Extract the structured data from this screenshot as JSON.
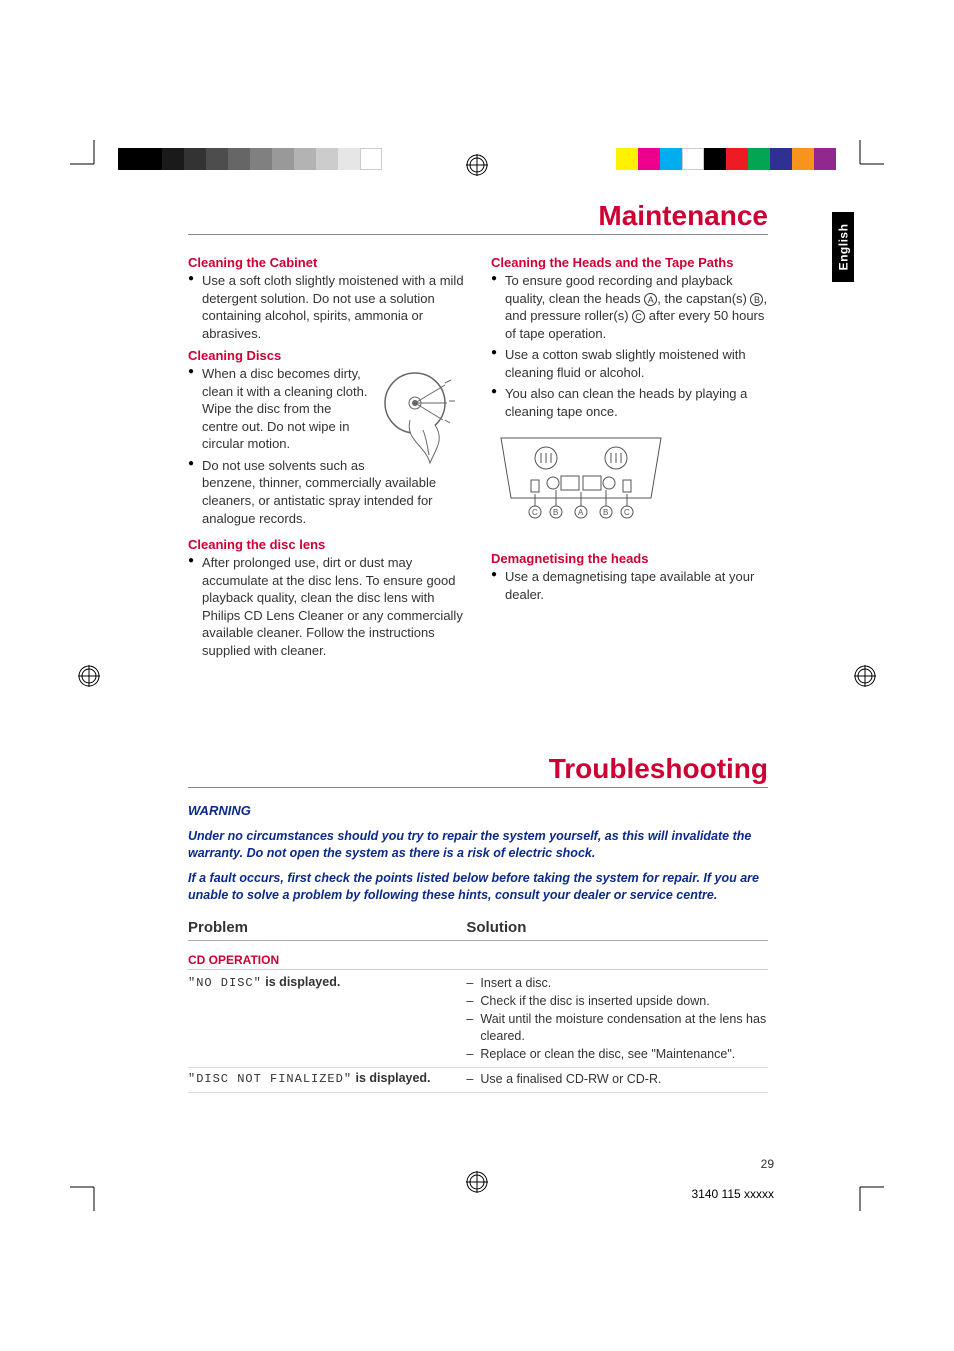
{
  "language_tab": "English",
  "section1": {
    "title": "Maintenance",
    "left": {
      "h1": "Cleaning the Cabinet",
      "b1": "Use a soft cloth slightly moistened with a mild detergent solution. Do not use a solution containing alcohol, spirits, ammonia or abrasives.",
      "h2": "Cleaning Discs",
      "b2": "When a disc becomes dirty, clean it with a cleaning cloth. Wipe the disc from the centre out.  Do not wipe in circular motion.",
      "b3": "Do not use solvents such as benzene, thinner, commercially available cleaners, or antistatic spray intended for analogue records.",
      "h3": "Cleaning the disc lens",
      "b4": "After prolonged use, dirt or dust may accumulate at the disc lens. To ensure good playback quality, clean the disc lens with Philips CD Lens Cleaner or any commercially available cleaner. Follow the instructions supplied with cleaner."
    },
    "right": {
      "h1": "Cleaning the Heads and the Tape Paths",
      "b1_pre": "To ensure good recording and playback quality, clean the heads ",
      "b1_a": "A",
      "b1_mid1": ", the capstan(s) ",
      "b1_b": "B",
      "b1_mid2": ", and pressure roller(s) ",
      "b1_c": "C",
      "b1_post": " after every 50 hours of tape operation.",
      "b2": "Use a cotton swab slightly moistened with cleaning fluid or alcohol.",
      "b3": "You also can clean the heads by playing a cleaning tape once.",
      "h2": "Demagnetising the heads",
      "b4": "Use a demagnetising tape available at your dealer."
    }
  },
  "section2": {
    "title": "Troubleshooting",
    "warning_title": "WARNING",
    "warning_p1": "Under no circumstances should you try to repair the system yourself, as this will invalidate the warranty.  Do not open the system as there is a risk of electric shock.",
    "warning_p2": "If a fault occurs, first check the points listed below before taking the system for repair. If you are unable to solve a problem by following these hints, consult your dealer or service centre.",
    "col_problem": "Problem",
    "col_solution": "Solution",
    "group1": "CD OPERATION",
    "rows": [
      {
        "problem_quote": "\"NO DISC\"",
        "problem_suffix": " is displayed.",
        "solutions": [
          "Insert a disc.",
          "Check if the disc is inserted upside down.",
          "Wait until the moisture condensation at the lens has cleared.",
          "Replace or clean the disc, see \"Maintenance\"."
        ]
      },
      {
        "problem_quote": "\"DISC NOT FINALIZED\"",
        "problem_suffix": " is displayed.",
        "solutions": [
          "Use a finalised CD-RW or CD-R."
        ]
      }
    ]
  },
  "page_number": "29",
  "doc_number": "3140 115 xxxxx",
  "colorbar_right": [
    "#f7e600",
    "#e4007f",
    "#00a0e9",
    "#fff",
    "#000",
    "#e4007f",
    "#f7e600",
    "#00a0e9",
    "#fff",
    "#000"
  ],
  "colorbar_left_gray_count": 7
}
